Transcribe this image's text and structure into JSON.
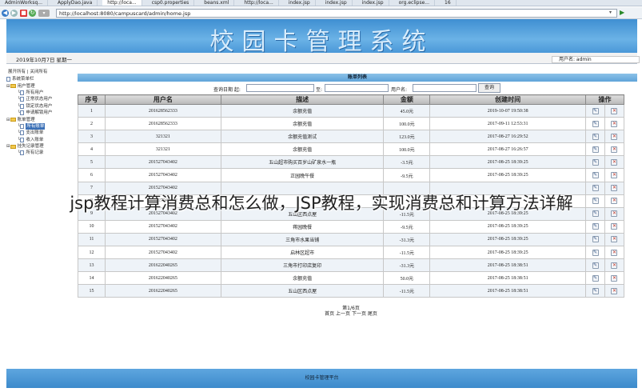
{
  "browser": {
    "tabs": [
      "AdminWorksq...",
      "ApplyDao.java",
      "http://loca...",
      "csp0.properties",
      "beans.xml",
      "http://loca...",
      "index.jsp",
      "index.jsp",
      "index.jsp",
      "org.eclipse...",
      "16"
    ],
    "url": "http://localhost:8080/campuscard/admin/home.jsp"
  },
  "banner": {
    "title": "校园卡管理系统"
  },
  "infobar": {
    "date": "2019年10月7日 星期一",
    "user": "用户名: admin"
  },
  "sidebar": {
    "head": "展开所有 | 关闭所有",
    "root": "系统菜单栏",
    "groups": [
      {
        "label": "用户管理",
        "items": [
          "所有用户",
          "正常状态用户",
          "锁定状态用户",
          "申请解锁用户"
        ]
      },
      {
        "label": "账单管理",
        "items": [
          "所有账单",
          "支出账单",
          "收入账单"
        ]
      },
      {
        "label": "挂失记录管理",
        "items": [
          "所有记录"
        ]
      }
    ]
  },
  "main": {
    "list_title": "账单列表",
    "search": {
      "date_label": "查询日期 起:",
      "to_label": "至:",
      "user_label": "用户名:",
      "button": "查询"
    },
    "columns": [
      "序号",
      "用户名",
      "描述",
      "金额",
      "创建时间",
      "操作"
    ],
    "rows": [
      {
        "no": "1",
        "user": "201628562333",
        "desc": "余额充值",
        "amount": "45.0元",
        "time": "2019-10-07 19:50:38"
      },
      {
        "no": "2",
        "user": "201628562333",
        "desc": "余额充值",
        "amount": "100.0元",
        "time": "2017-09-11 12:53:31"
      },
      {
        "no": "3",
        "user": "321321",
        "desc": "余额充值测试",
        "amount": "123.0元",
        "time": "2017-08-27 16:29:52"
      },
      {
        "no": "4",
        "user": "321321",
        "desc": "余额充值",
        "amount": "100.0元",
        "time": "2017-08-27 16:26:57"
      },
      {
        "no": "5",
        "user": "201527043402",
        "desc": "五山超市购买百岁山矿泉水一瓶",
        "amount": "-3.5元",
        "time": "2017-08-25 18:39:25"
      },
      {
        "no": "6",
        "user": "201527043402",
        "desc": "正园晚午餐",
        "amount": "-9.5元",
        "time": "2017-08-25 18:39:25"
      },
      {
        "no": "7",
        "user": "201527043402",
        "desc": "",
        "amount": "",
        "time": ""
      },
      {
        "no": "8",
        "user": "201527043402",
        "desc": "",
        "amount": "",
        "time": ""
      },
      {
        "no": "9",
        "user": "201527043402",
        "desc": "五山区西点屋",
        "amount": "-11.5元",
        "time": "2017-08-25 18:39:25"
      },
      {
        "no": "10",
        "user": "201527043402",
        "desc": "蒋园晚餐",
        "amount": "-9.5元",
        "time": "2017-08-25 18:39:25"
      },
      {
        "no": "11",
        "user": "201527043402",
        "desc": "三角市水果当铺",
        "amount": "-31.3元",
        "time": "2017-08-25 18:39:25"
      },
      {
        "no": "12",
        "user": "201527043402",
        "desc": "启林区超市",
        "amount": "-11.5元",
        "time": "2017-08-25 18:39:25"
      },
      {
        "no": "13",
        "user": "201622040265",
        "desc": "三角市打印店复印",
        "amount": "-31.3元",
        "time": "2017-08-25 18:38:51"
      },
      {
        "no": "14",
        "user": "201622040265",
        "desc": "余额充值",
        "amount": "50.0元",
        "time": "2017-08-25 18:38:51"
      },
      {
        "no": "15",
        "user": "201622040265",
        "desc": "五山区西点屋",
        "amount": "-11.5元",
        "time": "2017-08-25 18:38:51"
      }
    ],
    "pager": {
      "page": "第1/6页",
      "links": "首页 上一页 下一页 尾页"
    }
  },
  "footer": {
    "text": "校园卡管理平台"
  },
  "overlay": {
    "text": "jsp教程计算消费总和怎么做，JSP教程，实现消费总和计算方法详解"
  }
}
